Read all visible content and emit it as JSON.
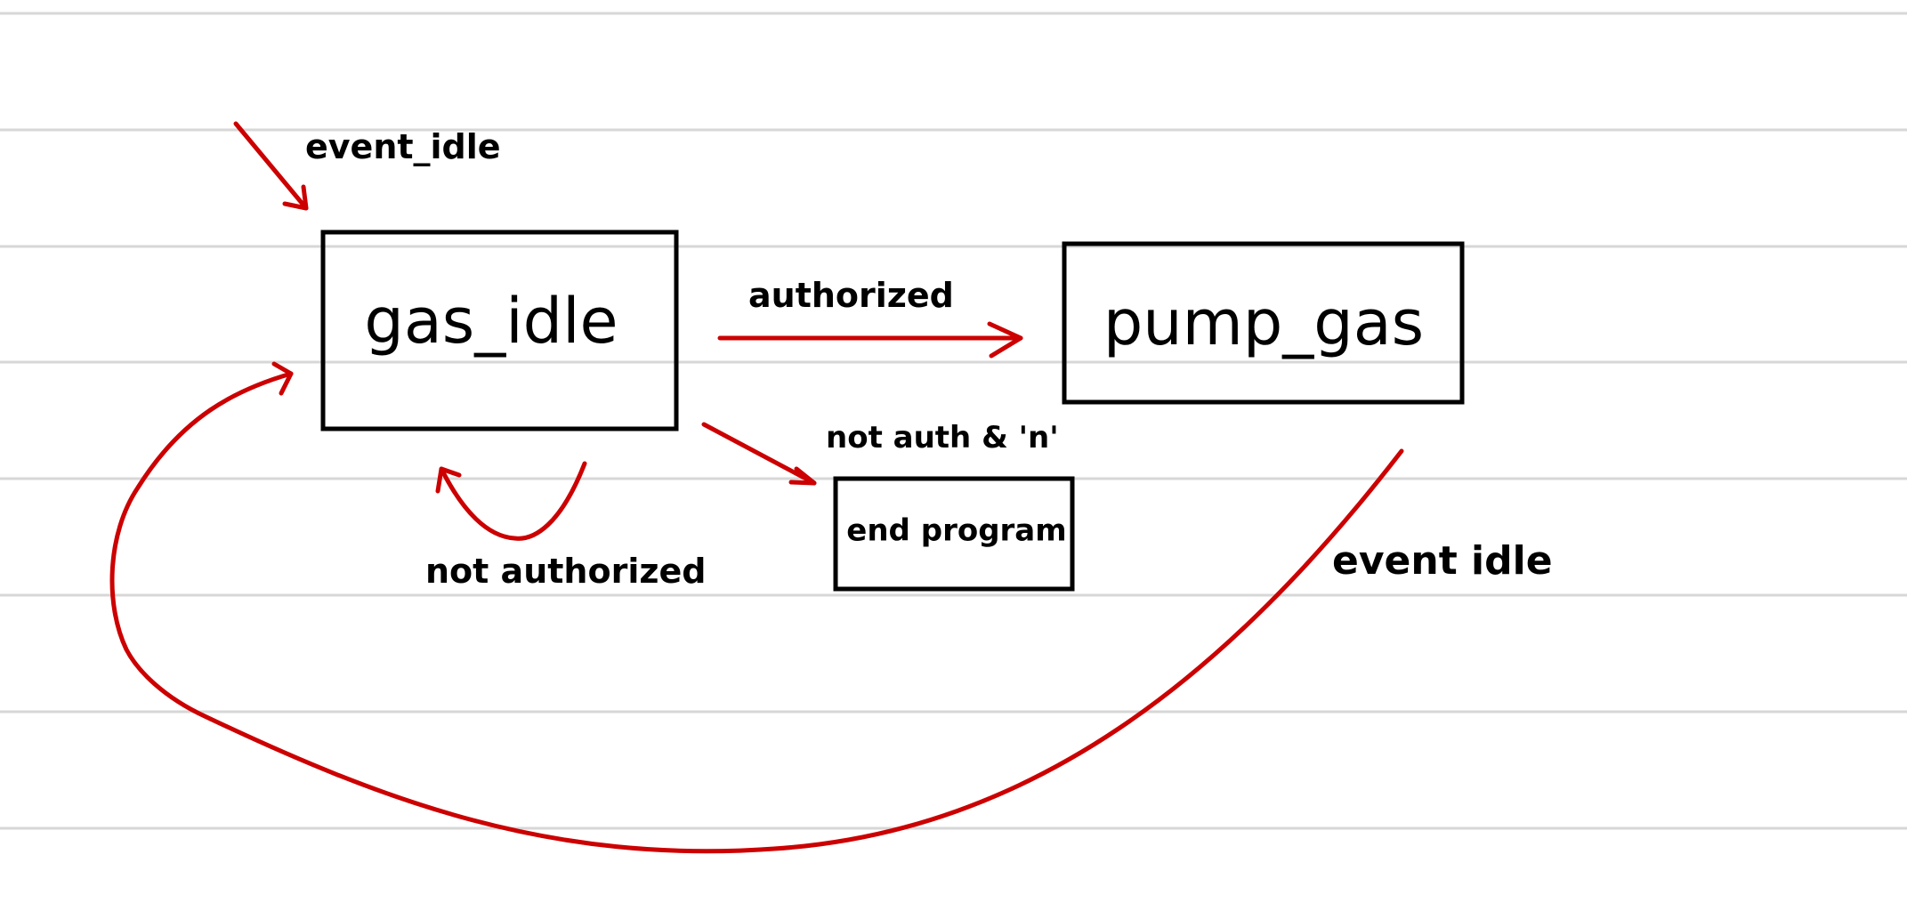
{
  "colors": {
    "paper": "#ffffff",
    "ruled_line": "#d7d7d7",
    "state_outline": "#000000",
    "transition": "#cc0000",
    "text": "#000000"
  },
  "states": {
    "gas_idle": "gas_idle",
    "pump_gas": "pump_gas",
    "end_program": "end program"
  },
  "transitions": {
    "initial": "event_idle",
    "authorized": "authorized",
    "not_authorized": "not authorized",
    "not_auth_n": "not auth & 'n'",
    "event_idle_return": "event idle"
  }
}
